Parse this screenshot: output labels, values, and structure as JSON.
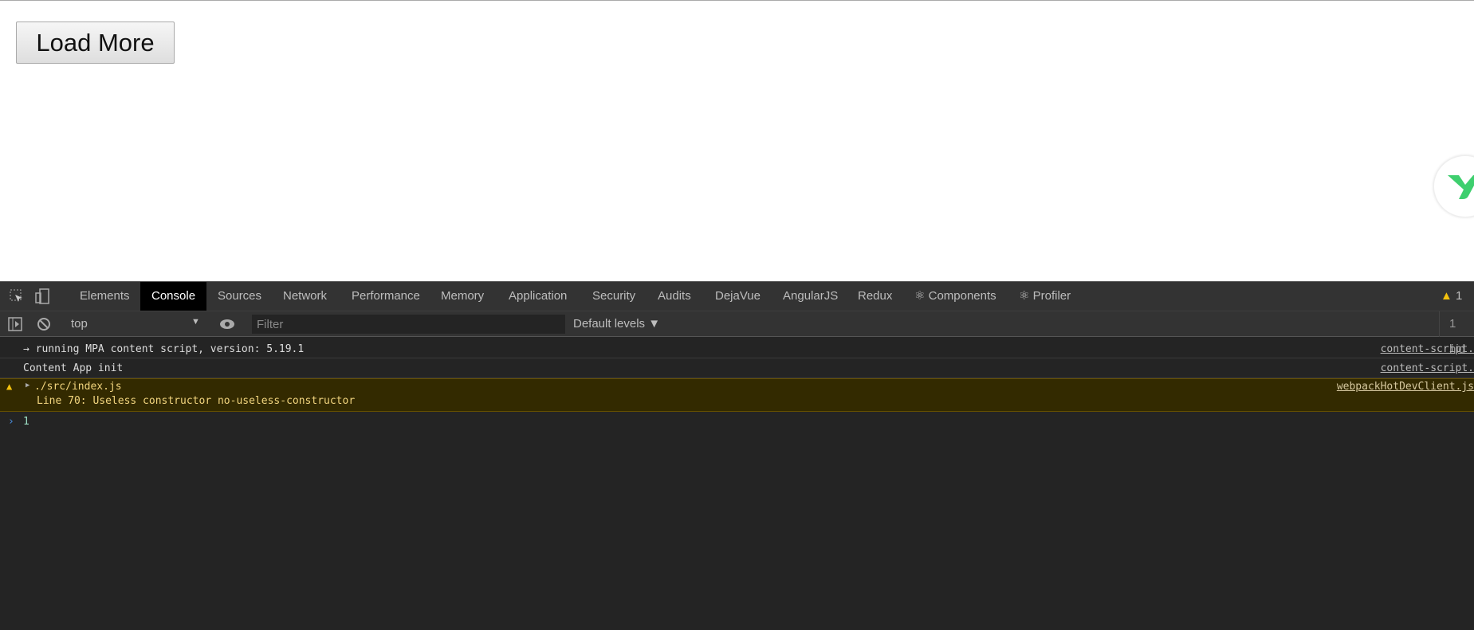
{
  "page": {
    "load_more_label": "Load More"
  },
  "devtools": {
    "tabs": [
      "Elements",
      "Console",
      "Sources",
      "Network",
      "Performance",
      "Memory",
      "Application",
      "Security",
      "Audits",
      "DejaVue",
      "AngularJS",
      "Redux",
      "⚛ Components",
      "⚛ Profiler"
    ],
    "active_tab": "Console",
    "warning_count": "1",
    "toolbar": {
      "context": "top",
      "filter_placeholder": "Filter",
      "levels": "Default levels ▼",
      "hidden": "1 hid"
    },
    "console": [
      {
        "text": "→ running MPA content script, version: 5.19.1",
        "source": "content-script."
      },
      {
        "text": "Content App init",
        "source": "content-script."
      },
      {
        "level": "warning",
        "text": "./src/index.js",
        "detail": "Line 70:  Useless constructor  no-useless-constructor",
        "source": "webpackHotDevClient.js"
      }
    ],
    "prompt_value": "1"
  },
  "colors": {
    "warning_bg": "#332a00",
    "warning_text": "#f2d57e",
    "logo_green": "#3ecf6e"
  }
}
